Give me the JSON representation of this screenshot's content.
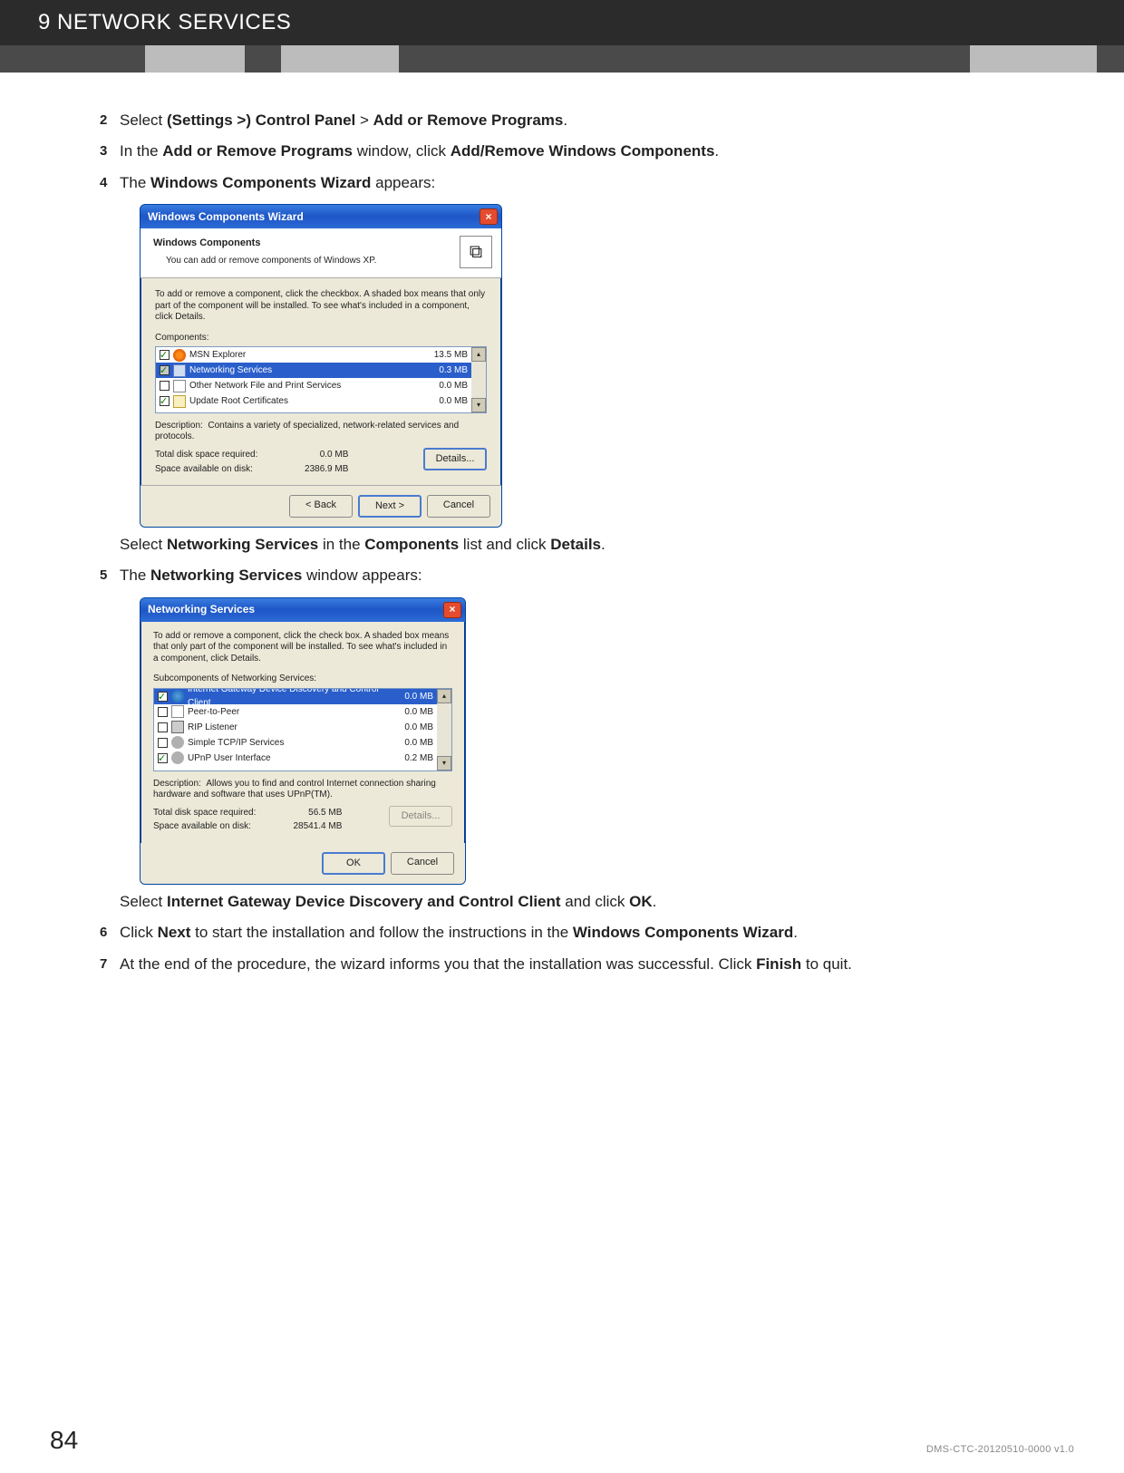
{
  "header": {
    "title": "9 NETWORK SERVICES"
  },
  "steps": {
    "s2a": "Select ",
    "s2b": "(Settings >) Control Panel",
    "s2c": " > ",
    "s2d": "Add or Remove Programs",
    "s2e": ".",
    "s3a": "In the ",
    "s3b": "Add or Remove Programs",
    "s3c": " window, click ",
    "s3d": "Add/Remove Windows Components",
    "s3e": ".",
    "s4a": "The ",
    "s4b": "Windows Components Wizard",
    "s4c": " appears:",
    "s4posta": "Select ",
    "s4postb": "Networking Services",
    "s4postc": " in the ",
    "s4postd": "Components",
    "s4poste": " list and click ",
    "s4postf": "Details",
    "s4postg": ".",
    "s5a": "The ",
    "s5b": "Networking Services",
    "s5c": " window appears:",
    "s5posta": "Select ",
    "s5postb": "Internet Gateway Device Discovery and Control Client",
    "s5postc": " and click ",
    "s5postd": "OK",
    "s5poste": ".",
    "s6a": "Click ",
    "s6b": "Next",
    "s6c": " to start the installation and follow the instructions in the ",
    "s6d": "Windows Components Wizard",
    "s6e": ".",
    "s7a": "At the end of the procedure, the wizard informs you that the installation was successful. Click ",
    "s7b": "Finish",
    "s7c": " to quit."
  },
  "wizard1": {
    "title": "Windows Components Wizard",
    "headerTitle": "Windows Components",
    "headerSub": "You can add or remove components of Windows XP.",
    "intro": "To add or remove a component, click the checkbox. A shaded box means that only part of the component will be installed. To see what's included in a component, click Details.",
    "componentsLabel": "Components:",
    "rows": [
      {
        "label": "MSN Explorer",
        "size": "13.5 MB",
        "checked": true,
        "shaded": false,
        "icon": "ic-butterfly"
      },
      {
        "label": "Networking Services",
        "size": "0.3 MB",
        "checked": true,
        "shaded": true,
        "selected": true,
        "icon": "ic-net"
      },
      {
        "label": "Other Network File and Print Services",
        "size": "0.0 MB",
        "checked": false,
        "shaded": false,
        "icon": "ic-file"
      },
      {
        "label": "Update Root Certificates",
        "size": "0.0 MB",
        "checked": true,
        "shaded": false,
        "icon": "ic-cert"
      }
    ],
    "descLabel": "Description:",
    "descText": "Contains a variety of specialized, network-related services and protocols.",
    "reqLabel": "Total disk space required:",
    "reqVal": "0.0 MB",
    "availLabel": "Space available on disk:",
    "availVal": "2386.9 MB",
    "btnDetails": "Details...",
    "btnBack": "< Back",
    "btnNext": "Next >",
    "btnCancel": "Cancel"
  },
  "wizard2": {
    "title": "Networking Services",
    "intro": "To add or remove a component, click the check box. A shaded box means that only part of the component will be installed. To see what's included in a component, click Details.",
    "subLabel": "Subcomponents of Networking Services:",
    "rows": [
      {
        "label": "Internet Gateway Device Discovery and Control Client",
        "size": "0.0 MB",
        "checked": true,
        "selected": true,
        "icon": "ic-globe"
      },
      {
        "label": "Peer-to-Peer",
        "size": "0.0 MB",
        "checked": false,
        "icon": "ic-file"
      },
      {
        "label": "RIP Listener",
        "size": "0.0 MB",
        "checked": false,
        "icon": "ic-printer"
      },
      {
        "label": "Simple TCP/IP Services",
        "size": "0.0 MB",
        "checked": false,
        "icon": "ic-gear"
      },
      {
        "label": "UPnP User Interface",
        "size": "0.2 MB",
        "checked": true,
        "icon": "ic-gear"
      }
    ],
    "descLabel": "Description:",
    "descText": "Allows you to find and control Internet connection sharing hardware and software that uses UPnP(TM).",
    "reqLabel": "Total disk space required:",
    "reqVal": "56.5 MB",
    "availLabel": "Space available on disk:",
    "availVal": "28541.4 MB",
    "btnDetails": "Details...",
    "btnOK": "OK",
    "btnCancel": "Cancel"
  },
  "footer": {
    "pageNum": "84",
    "docCode": "DMS-CTC-20120510-0000 v1.0"
  }
}
